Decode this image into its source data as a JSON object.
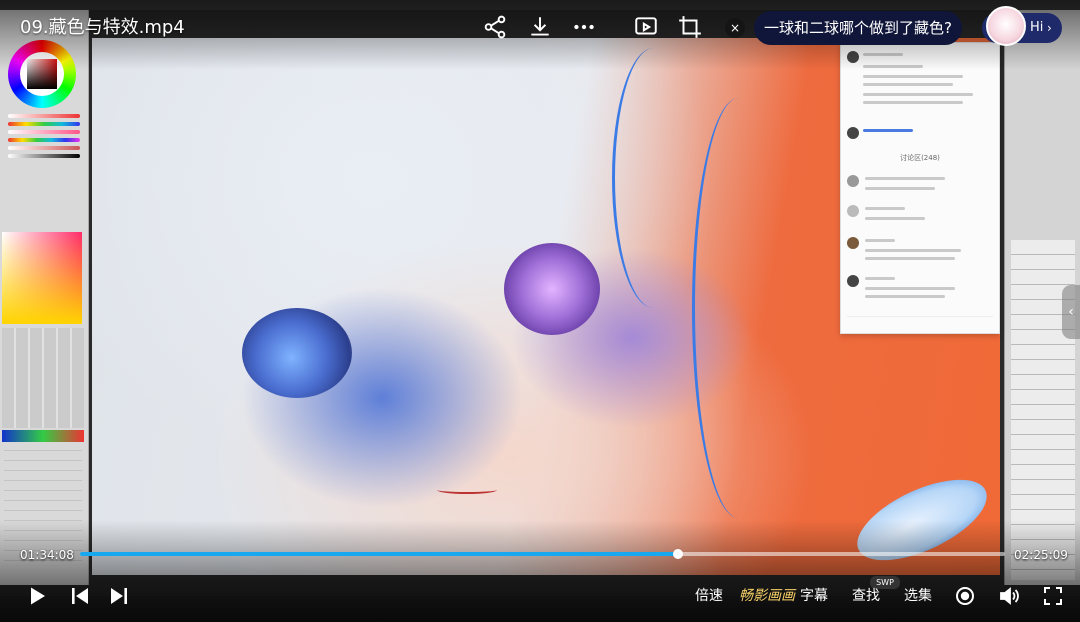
{
  "video": {
    "title": "09.藏色与特效.mp4",
    "current_time": "01:34:08",
    "duration": "02:25:09",
    "progress": 0.647
  },
  "top_bar": {
    "close_label": "×",
    "ai_question": "一球和二球哪个做到了藏色?",
    "hi_label": "Hi",
    "hi_chevron": "›"
  },
  "controls": {
    "speed_label": "倍速",
    "quality_label": "畅影画画",
    "subtitle_label": "字幕",
    "search_label": "查找",
    "episodes_label": "选集",
    "swp_badge": "SWP"
  },
  "recording": {
    "chat_heading": "讨论区(248)"
  },
  "side_handle": "‹",
  "colors": {
    "accent": "#18a8f0",
    "ai_bubble_bg": "#10163a",
    "quality_accent": "#f7d067"
  }
}
